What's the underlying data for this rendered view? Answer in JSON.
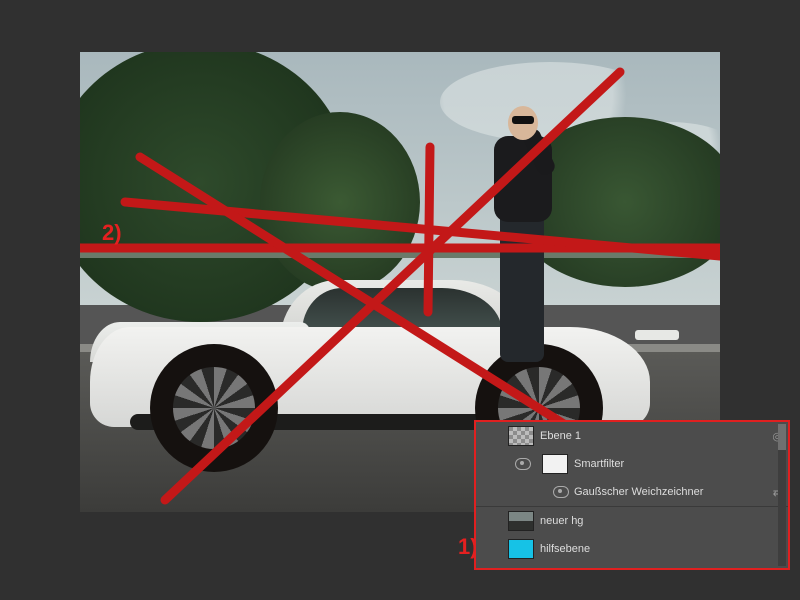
{
  "annotations": {
    "one": "1)",
    "two": "2)"
  },
  "layers_panel": {
    "rows": [
      {
        "name": "Ebene 1"
      },
      {
        "name": "Smartfilter"
      },
      {
        "name": "Gaußscher Weichzeichner"
      },
      {
        "name": "neuer hg"
      },
      {
        "name": "hilfsebene"
      }
    ]
  },
  "colors": {
    "accent_red": "#e02020",
    "cyan": "#16c2e6"
  }
}
